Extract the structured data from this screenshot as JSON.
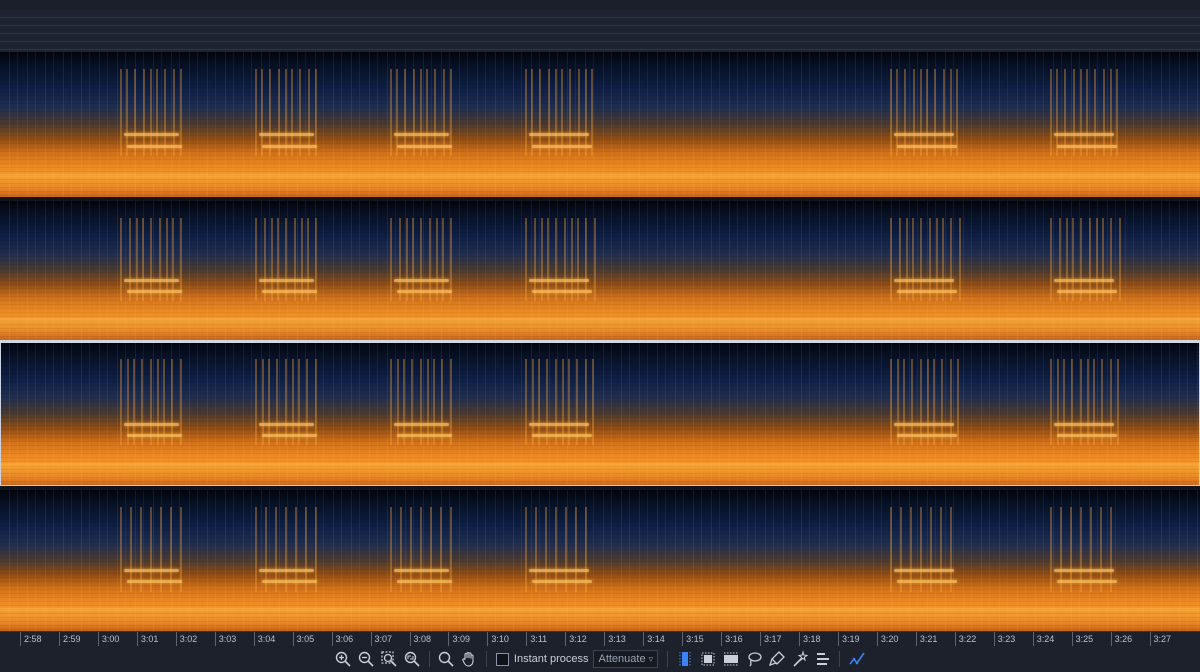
{
  "timeline": {
    "ticks": [
      "2:58",
      "2:59",
      "3:00",
      "3:01",
      "3:02",
      "3:03",
      "3:04",
      "3:05",
      "3:06",
      "3:07",
      "3:08",
      "3:09",
      "3:10",
      "3:11",
      "3:12",
      "3:13",
      "3:14",
      "3:15",
      "3:16",
      "3:17",
      "3:18",
      "3:19",
      "3:20",
      "3:21",
      "3:22",
      "3:23",
      "3:24",
      "3:25",
      "3:26",
      "3:27"
    ]
  },
  "spectrogram": {
    "channels": 4,
    "colormap": [
      "#02050b",
      "#0e1f44",
      "#8f4d14",
      "#ee8b22",
      "#ffc35e"
    ]
  },
  "toolbar": {
    "instant_process_label": "Instant process",
    "instant_process_checked": false,
    "mode_value": "Attenuate",
    "accent_color": "#3b82f6"
  },
  "icons": [
    "zoom-in-icon",
    "zoom-out-icon",
    "zoom-selection-icon",
    "zoom-fit-icon",
    "magnify-icon",
    "hand-icon",
    "time-selection-icon",
    "frequency-selection-icon",
    "time-frequency-selection-icon",
    "lasso-icon",
    "brush-icon",
    "magic-wand-icon",
    "harmonic-selection-icon",
    "spectral-curve-icon"
  ]
}
